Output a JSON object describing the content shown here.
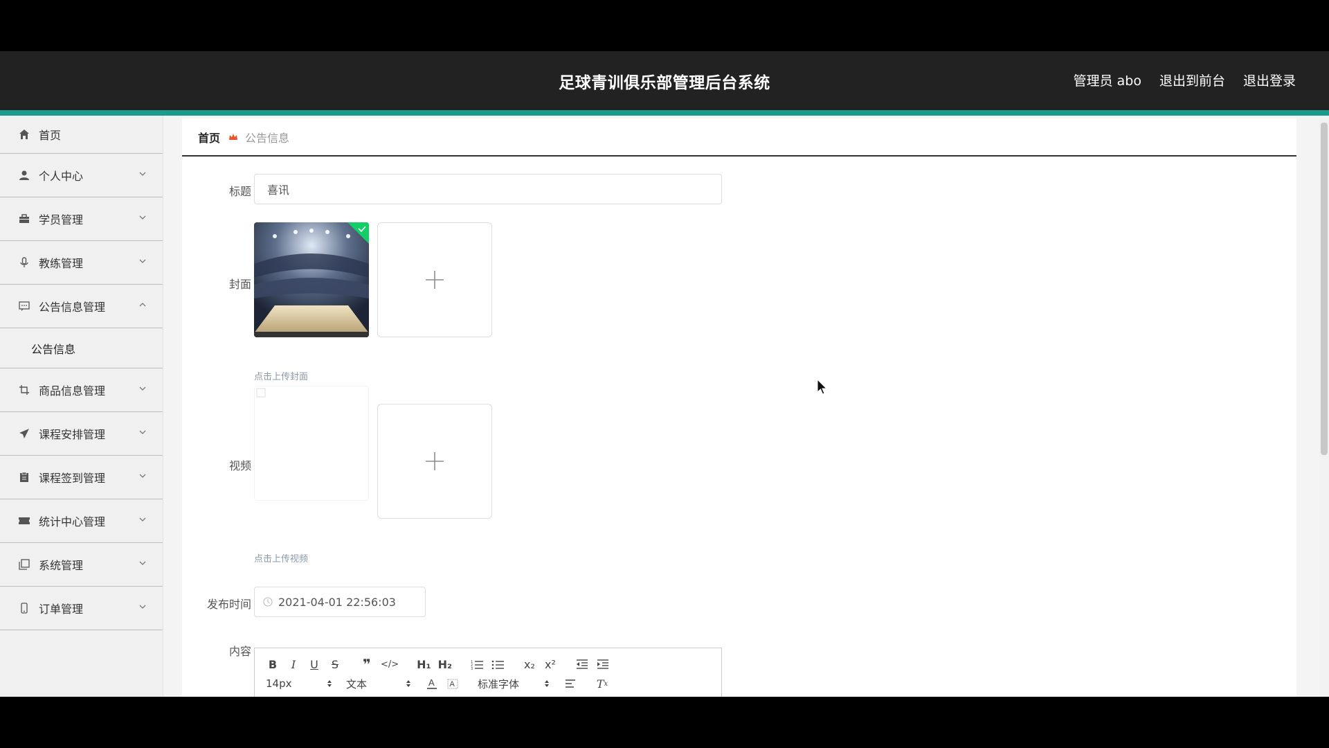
{
  "header": {
    "title": "足球青训俱乐部管理后台系统",
    "nav": [
      "管理员 abo",
      "退出到前台",
      "退出登录"
    ]
  },
  "sidebar": {
    "items": [
      {
        "label": "首页",
        "icon": "home-icon"
      },
      {
        "label": "个人中心",
        "icon": "user-icon"
      },
      {
        "label": "学员管理",
        "icon": "briefcase-icon"
      },
      {
        "label": "教练管理",
        "icon": "microphone-icon"
      },
      {
        "label": "公告信息管理",
        "icon": "chat-icon",
        "expanded": true,
        "children": [
          "公告信息"
        ]
      },
      {
        "label": "商品信息管理",
        "icon": "crop-icon"
      },
      {
        "label": "课程安排管理",
        "icon": "send-icon"
      },
      {
        "label": "课程签到管理",
        "icon": "clipboard-icon"
      },
      {
        "label": "统计中心管理",
        "icon": "ticket-icon"
      },
      {
        "label": "系统管理",
        "icon": "copy-icon"
      },
      {
        "label": "订单管理",
        "icon": "phone-icon"
      }
    ]
  },
  "breadcrumb": {
    "home": "首页",
    "current": "公告信息"
  },
  "form": {
    "title_label": "标题",
    "title_value": "喜讯",
    "cover_label": "封面",
    "cover_hint": "点击上传封面",
    "video_label": "视频",
    "video_hint": "点击上传视频",
    "publish_label": "发布时间",
    "publish_value": "2021-04-01 22:56:03",
    "content_label": "内容"
  },
  "editor": {
    "font_size": "14px",
    "block_format": "文本",
    "font_family": "标准字体"
  },
  "colors": {
    "header_bg": "#222222",
    "accent": "#1a9b8c",
    "success_badge": "#13ce66",
    "breadcrumb_sep": "#e8542c"
  }
}
